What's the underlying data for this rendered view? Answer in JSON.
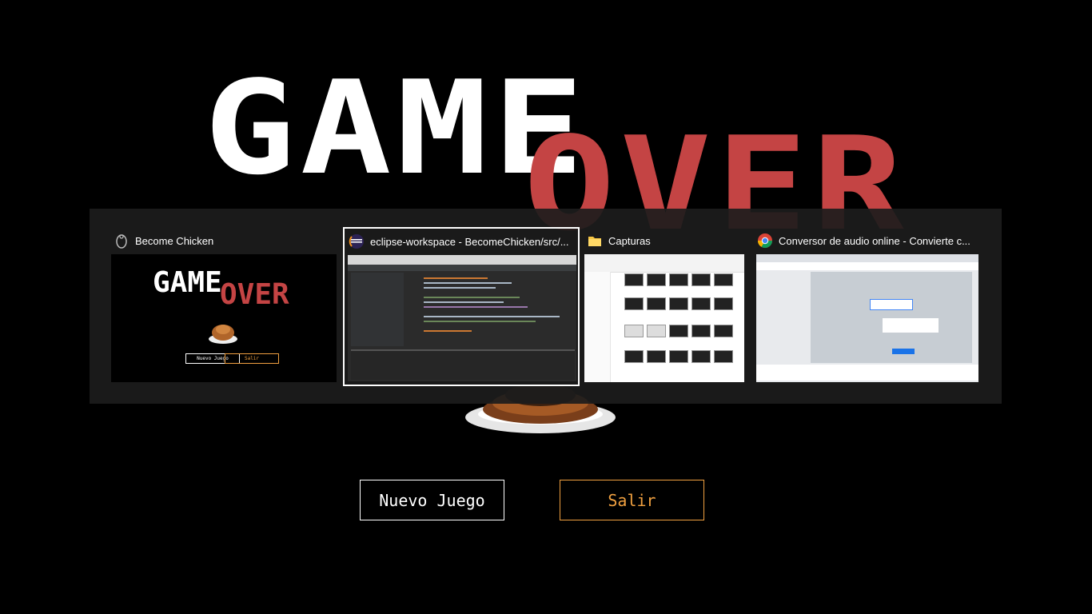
{
  "game": {
    "title_word1": "GAME",
    "title_word2": "OVER",
    "buttons": {
      "new_game": "Nuevo Juego",
      "exit": "Salir"
    }
  },
  "task_switcher": {
    "windows": [
      {
        "title": "Become Chicken",
        "icon": "chicken-app-icon",
        "selected": false,
        "thumb": {
          "word1": "GAME",
          "word2": "OVER",
          "btn1": "Nuevo Juego",
          "btn2": "Salir"
        }
      },
      {
        "title": "eclipse-workspace - BecomeChicken/src/...",
        "icon": "eclipse-icon",
        "selected": true
      },
      {
        "title": "Capturas",
        "icon": "folder-icon",
        "selected": false
      },
      {
        "title": "Conversor de audio online - Convierte c...",
        "icon": "chrome-icon",
        "selected": false
      }
    ]
  },
  "colors": {
    "accent_red": "#c44444",
    "accent_orange": "#f0a040",
    "switcher_bg": "#1c1c1c"
  }
}
